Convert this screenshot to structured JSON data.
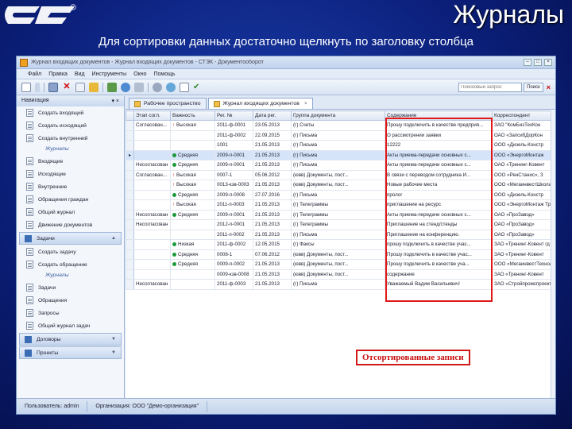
{
  "slide": {
    "logo_text": "СТЭК",
    "title": "Журналы",
    "subtitle": "Для сортировки данных достаточно щелкнуть по заголовку столбца"
  },
  "window": {
    "title": "Журнал входящих документов - Журнал входящих документов - СТЭК - Документооборот",
    "menu": [
      "Файл",
      "Правка",
      "Вид",
      "Инструменты",
      "Окно",
      "Помощь"
    ],
    "search_placeholder": "Поисковый запрос",
    "search_button": "Поиск"
  },
  "nav": {
    "header": "Навигация",
    "pins": "▾ ×",
    "docs_items": [
      "Создать входящий",
      "Создать исходящий",
      "Создать внутренний"
    ],
    "journals_label_1": "Журналы",
    "journal_items": [
      "Входящие",
      "Исходящие",
      "Внутренние",
      "Обращения граждан",
      "Общий журнал",
      "Движение документов"
    ],
    "tasks_section": "Задачи",
    "task_create_items": [
      "Создать задачу",
      "Создать обращение"
    ],
    "journals_label_2": "Журналы",
    "task_journal_items": [
      "Задачи",
      "Обращения",
      "Запросы",
      "Общий журнал задач"
    ],
    "contracts_section": "Договоры",
    "projects_section": "Проекты"
  },
  "tabs": [
    "Рабочее пространство",
    "Журнал входящих документов"
  ],
  "table": {
    "columns": [
      "Этап согл.",
      "Важность",
      "Рег. №",
      "Дата рег.",
      "Группа документа",
      "Содержание",
      "Корреспондент"
    ],
    "rows": [
      [
        "Согласован...",
        "Высокая",
        "2011-ф-0001",
        "23.05.2013",
        "(г) Счеты",
        "Прошу подключить в качестве предприя...",
        "ЗАО \"КомБизТехКон"
      ],
      [
        "",
        "",
        "2011-ф-0002",
        "22.09.2015",
        "(г) Письма",
        "О рассмотрении заявки",
        "ОАО «ЗапсибДорКон"
      ],
      [
        "",
        "",
        "1001",
        "21.05.2013",
        "(г) Письма",
        "12222",
        "ООО «Дизель-Констр"
      ],
      [
        "",
        "Средняя",
        "2009-п-0001",
        "21.05.2013",
        "(г) Письма",
        "Акты приема-передачи основных с...",
        "ООО «ЭнергоМонтаж"
      ],
      [
        "Несогласован",
        "Средняя",
        "2009-п-0001",
        "21.05.2013",
        "(г) Письма",
        "Акты приема-передачи основных с...",
        "ОАО «Тренинг-Ковент"
      ],
      [
        "Согласован...",
        "Высокая",
        "0007-1",
        "05.06.2012",
        "(ювв) Документы, пост...",
        "В связи с переводом сотрудника И...",
        "ООО «РенСтанис», З"
      ],
      [
        "",
        "Высокая",
        "0013-кзв-0003",
        "21.05.2013",
        "(ювв) Документы, пост...",
        "Новые рабочие места",
        "ООО «МегаинвестШкола"
      ],
      [
        "",
        "Средняя",
        "2009-п-0008",
        "27.07.2016",
        "(г) Письма",
        "пролог",
        "ООО «Дизель-Констр"
      ],
      [
        "",
        "Высокая",
        "2011-п-0003",
        "21.05.2013",
        "(г) Телеграммы",
        "приглашение на ресурс",
        "ООО «ЭнергоМонтаж Тре"
      ],
      [
        "Несогласован",
        "Средняя",
        "2009-п-0001",
        "21.05.2013",
        "(г) Телеграммы",
        "Акты приема-передачи основных с...",
        "ОАО «ПроЗавод»"
      ],
      [
        "Несогласован",
        "",
        "2012-п-0001",
        "21.05.2013",
        "(г) Телеграммы",
        "Приглашение на стенд/стенды",
        "ОАО «ПроЗавод»"
      ],
      [
        "",
        "",
        "2011-п-0002",
        "21.05.2013",
        "(г) Письма",
        "Приглашение на конференцию.",
        "ОАО «ПроЗавод»"
      ],
      [
        "",
        "Низкая",
        "2011-ф-0002",
        "12.05.2015",
        "(г) Факсы",
        "прошу подключить в качестве учас...",
        "ЗАО «Тренинг-Ковент гд"
      ],
      [
        "",
        "Средняя",
        "0008-1",
        "07.06.2012",
        "(ювв) Документы, пост...",
        "Прошу подключить в качестве учас...",
        "ЗАО «Тренинг-Ковент"
      ],
      [
        "",
        "Средняя",
        "0009-п-0002",
        "21.05.2013",
        "(ювв) Документы, пост...",
        "Прошу подключить в качестве уча...",
        "ООО «МегаинвестТехнолог"
      ],
      [
        "",
        "",
        "0009-кзв-0008",
        "21.05.2013",
        "(ювв) Документы, пост...",
        "содержание",
        "ЗАО «Тренинг-Ковент"
      ],
      [
        "Несогласован",
        "",
        "2011-ф-0003",
        "21.05.2013",
        "(г) Письма",
        "Уважаемый Вадим Васильевич!",
        "ЗАО «Стройпромспроект»"
      ]
    ]
  },
  "sorted_label": "Отсортированные записи",
  "status": {
    "user": "Пользователь: admin",
    "org": "Организация: ООО \"Демо-организация\""
  },
  "colors": {
    "highlight": "#e01818",
    "importance_high": "#c00000",
    "importance_medium": "#1a9a3a",
    "importance_low": "#1a9a3a"
  }
}
